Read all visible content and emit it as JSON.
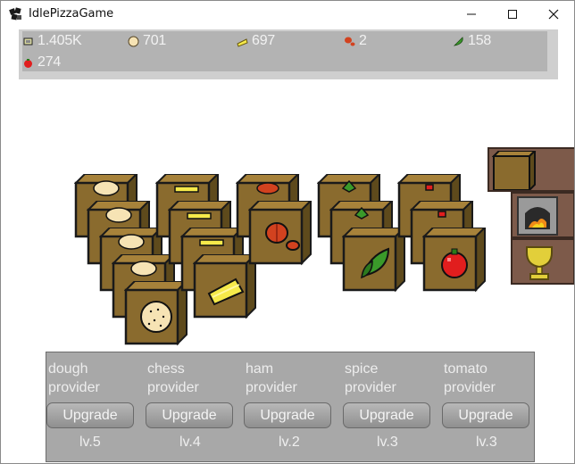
{
  "window": {
    "title": "IdlePizzaGame"
  },
  "resources": [
    {
      "name": "money",
      "icon": "money-icon",
      "value": "1.405K"
    },
    {
      "name": "dough",
      "icon": "dough-icon",
      "value": "701"
    },
    {
      "name": "cheese",
      "icon": "cheese-icon",
      "value": "697"
    },
    {
      "name": "ham",
      "icon": "ham-icon",
      "value": "2"
    },
    {
      "name": "spice",
      "icon": "spice-icon",
      "value": "158"
    },
    {
      "name": "tomato",
      "icon": "tomato-icon",
      "value": "274"
    }
  ],
  "providers": [
    {
      "line1": "dough",
      "line2": "provider",
      "button": "Upgrade",
      "level": "lv.5"
    },
    {
      "line1": "chess",
      "line2": "provider",
      "button": "Upgrade",
      "level": "lv.4"
    },
    {
      "line1": "ham",
      "line2": "provider",
      "button": "Upgrade",
      "level": "lv.2"
    },
    {
      "line1": "spice",
      "line2": "provider",
      "button": "Upgrade",
      "level": "lv.3"
    },
    {
      "line1": "tomato",
      "line2": "provider",
      "button": "Upgrade",
      "level": "lv.3"
    }
  ],
  "tools": [
    {
      "name": "crate-tool",
      "icon": "box-icon"
    },
    {
      "name": "oven-tool",
      "icon": "oven-icon"
    },
    {
      "name": "trophy-tool",
      "icon": "trophy-icon"
    }
  ],
  "colors": {
    "crate": "#8a6b2e",
    "crate_dark": "#5e4a1c",
    "crate_outline": "#1a1a1a",
    "dough": "#f6e3b4",
    "cheese": "#f6ea4a",
    "ham": "#d2421f",
    "spice": "#3a9a2a",
    "tomato": "#e11e1e",
    "tool_bg": "#7d5a4a"
  }
}
